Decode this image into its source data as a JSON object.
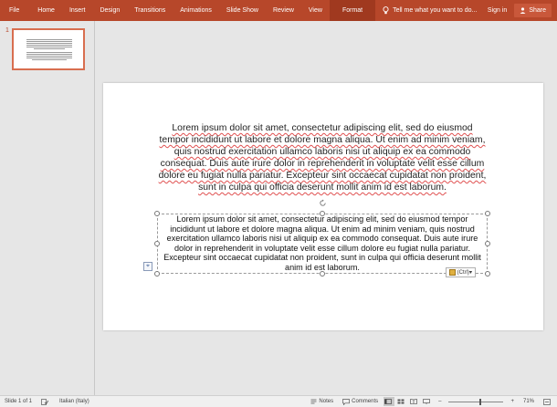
{
  "ribbon": {
    "tabs": [
      "File",
      "Home",
      "Insert",
      "Design",
      "Transitions",
      "Animations",
      "Slide Show",
      "Review",
      "View",
      "Format"
    ],
    "active_tab": "Format",
    "tell_me": "Tell me what you want to do...",
    "sign_in": "Sign in",
    "share": "Share"
  },
  "thumbnails": {
    "slide_number": "1"
  },
  "slide": {
    "paragraph1": "Lorem ipsum dolor sit amet, consectetur adipiscing elit, sed do eiusmod tempor incididunt ut labore et dolore magna aliqua. Ut enim ad minim veniam, quis nostrud exercitation ullamco laboris nisi ut aliquip ex ea commodo consequat. Duis aute irure dolor in reprehenderit in voluptate velit esse cillum dolore eu fugiat nulla pariatur. Excepteur sint occaecat cupidatat non proident, sunt in culpa qui officia deserunt mollit anim id est laborum.",
    "paragraph2": "Lorem ipsum dolor sit amet, consectetur adipiscing elit, sed do eiusmod tempor incididunt ut labore et dolore magna aliqua. Ut enim ad minim veniam, quis nostrud exercitation ullamco laboris nisi ut aliquip ex ea commodo consequat. Duis aute irure dolor in reprehenderit in voluptate velit esse cillum dolore eu fugiat nulla pariatur. Excepteur sint occaecat cupidatat non proident, sunt in culpa qui officia deserunt mollit anim id est laborum.",
    "paste_options": "(Ctrl)"
  },
  "status": {
    "slide_indicator": "Slide 1 of 1",
    "language": "Italian (Italy)",
    "notes": "Notes",
    "comments": "Comments",
    "zoom": "71%"
  },
  "colors": {
    "accent": "#b7472a",
    "spellcheck": "#e05050"
  }
}
